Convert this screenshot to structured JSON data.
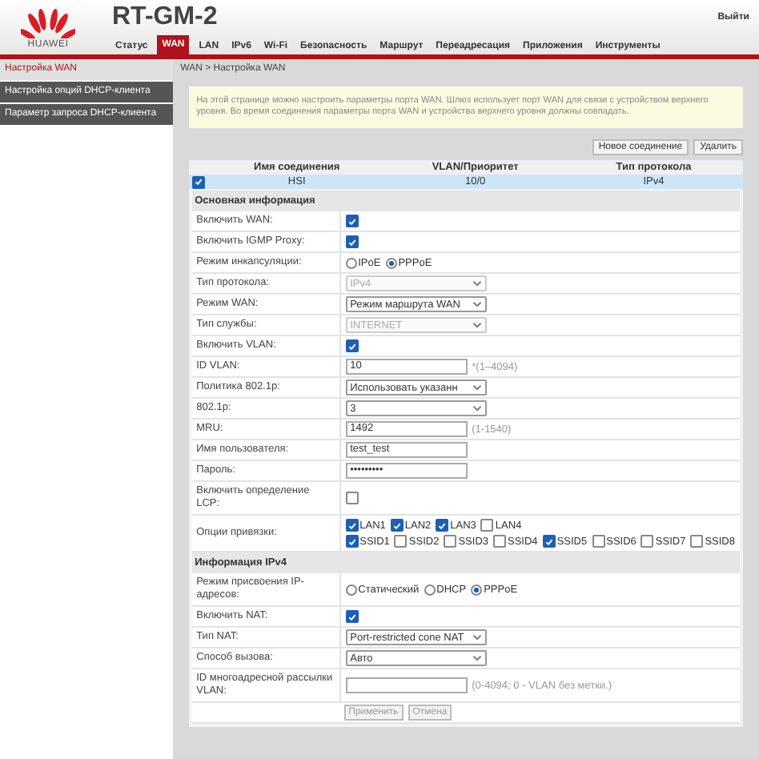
{
  "header": {
    "brand": "HUAWEI",
    "model": "RT-GM-2",
    "logout": "Выйти"
  },
  "nav": [
    {
      "label": "Статус",
      "selected": false
    },
    {
      "label": "WAN",
      "selected": true
    },
    {
      "label": "LAN",
      "selected": false
    },
    {
      "label": "IPv6",
      "selected": false
    },
    {
      "label": "Wi-Fi",
      "selected": false
    },
    {
      "label": "Безопасность",
      "selected": false
    },
    {
      "label": "Маршрут",
      "selected": false
    },
    {
      "label": "Переадресация",
      "selected": false
    },
    {
      "label": "Приложения",
      "selected": false
    },
    {
      "label": "Инструменты",
      "selected": false
    }
  ],
  "sidebar": {
    "items": [
      {
        "label": "Настройка WAN",
        "selected": true
      },
      {
        "label": "Настройка опций DHCP-клиента",
        "selected": false
      },
      {
        "label": "Параметр запроса DHCP-клиента",
        "selected": false
      }
    ]
  },
  "breadcrumb": "WAN > Настройка WAN",
  "notice": "На этой странице можно настроить параметры порта WAN. Шлюз использует порт WAN для связи с устройством верхнего уровня. Во время соединения параметры порта WAN и устройства верхнего уровня должны совпадать.",
  "actions": [
    "Новое соединение",
    "Удалить"
  ],
  "table": {
    "columns": [
      "Имя соединения",
      "VLAN/Приоритет",
      "Тип протокола"
    ],
    "rows": [
      {
        "checked": true,
        "selected": true,
        "cells": [
          "HSI",
          "10/0",
          "IPv4"
        ]
      }
    ]
  },
  "sections": [
    {
      "title": "Основная информация",
      "fields": [
        {
          "kind": "checkbox",
          "label": "Включить WAN:",
          "checked": true
        },
        {
          "kind": "checkbox",
          "label": "Включить IGMP Proxy:",
          "checked": true
        },
        {
          "kind": "radio",
          "label": "Режим инкапсуляции:",
          "options": [
            {
              "label": "IPoE",
              "selected": false
            },
            {
              "label": "PPPoE",
              "selected": true
            }
          ]
        },
        {
          "kind": "select",
          "label": "Тип протокола:",
          "value": "IPv4",
          "disabled": true
        },
        {
          "kind": "select",
          "label": "Режим WAN:",
          "value": "Режим маршрута WAN",
          "disabled": false
        },
        {
          "kind": "select",
          "label": "Тип службы:",
          "value": "INTERNET",
          "disabled": true
        },
        {
          "kind": "checkbox",
          "label": "Включить VLAN:",
          "checked": true
        },
        {
          "kind": "text",
          "label": "ID VLAN:",
          "value": "10",
          "hint": "*(1–4094)"
        },
        {
          "kind": "select",
          "label": "Политика 802.1p:",
          "value": "Использовать указанн",
          "disabled": false
        },
        {
          "kind": "select",
          "label": "802.1p:",
          "value": "3",
          "disabled": false
        },
        {
          "kind": "text",
          "label": "MRU:",
          "value": "1492",
          "hint": "(1-1540)"
        },
        {
          "kind": "text",
          "label": "Имя пользователя:",
          "value": "test_test"
        },
        {
          "kind": "text",
          "label": "Пароль:",
          "value": "•••••••••"
        },
        {
          "kind": "checkbox",
          "label": "Включить определение LCP:",
          "checked": false
        },
        {
          "kind": "checks",
          "label": "Опции привязки:",
          "groups": [
            [
              {
                "label": "LAN1",
                "checked": true
              },
              {
                "label": "LAN2",
                "checked": true
              },
              {
                "label": "LAN3",
                "checked": true
              },
              {
                "label": "LAN4",
                "checked": false
              }
            ],
            [
              {
                "label": "SSID1",
                "checked": true
              },
              {
                "label": "SSID2",
                "checked": false
              },
              {
                "label": "SSID3",
                "checked": false
              },
              {
                "label": "SSID4",
                "checked": false
              },
              {
                "label": "SSID5",
                "checked": true
              },
              {
                "label": "SSID6",
                "checked": false
              },
              {
                "label": "SSID7",
                "checked": false
              },
              {
                "label": "SSID8",
                "checked": false
              }
            ]
          ]
        }
      ]
    },
    {
      "title": "Информация IPv4",
      "fields": [
        {
          "kind": "radio",
          "label": "Режим присвоения IP-адресов:",
          "options": [
            {
              "label": "Статический",
              "selected": false
            },
            {
              "label": "DHCP",
              "selected": false
            },
            {
              "label": "PPPoE",
              "selected": true
            }
          ]
        },
        {
          "kind": "checkbox",
          "label": "Включить NAT:",
          "checked": true
        },
        {
          "kind": "select",
          "label": "Тип NAT:",
          "value": "Port-restricted cone NAT",
          "disabled": false
        },
        {
          "kind": "select",
          "label": "Способ вызова:",
          "value": "Авто",
          "disabled": false
        },
        {
          "kind": "text",
          "label": "ID многоадресной рассылки VLAN:",
          "hint": "(0-4094; 0 - VLAN без метки.)"
        }
      ]
    }
  ],
  "form_buttons": [
    "Применить",
    "Отмена"
  ]
}
